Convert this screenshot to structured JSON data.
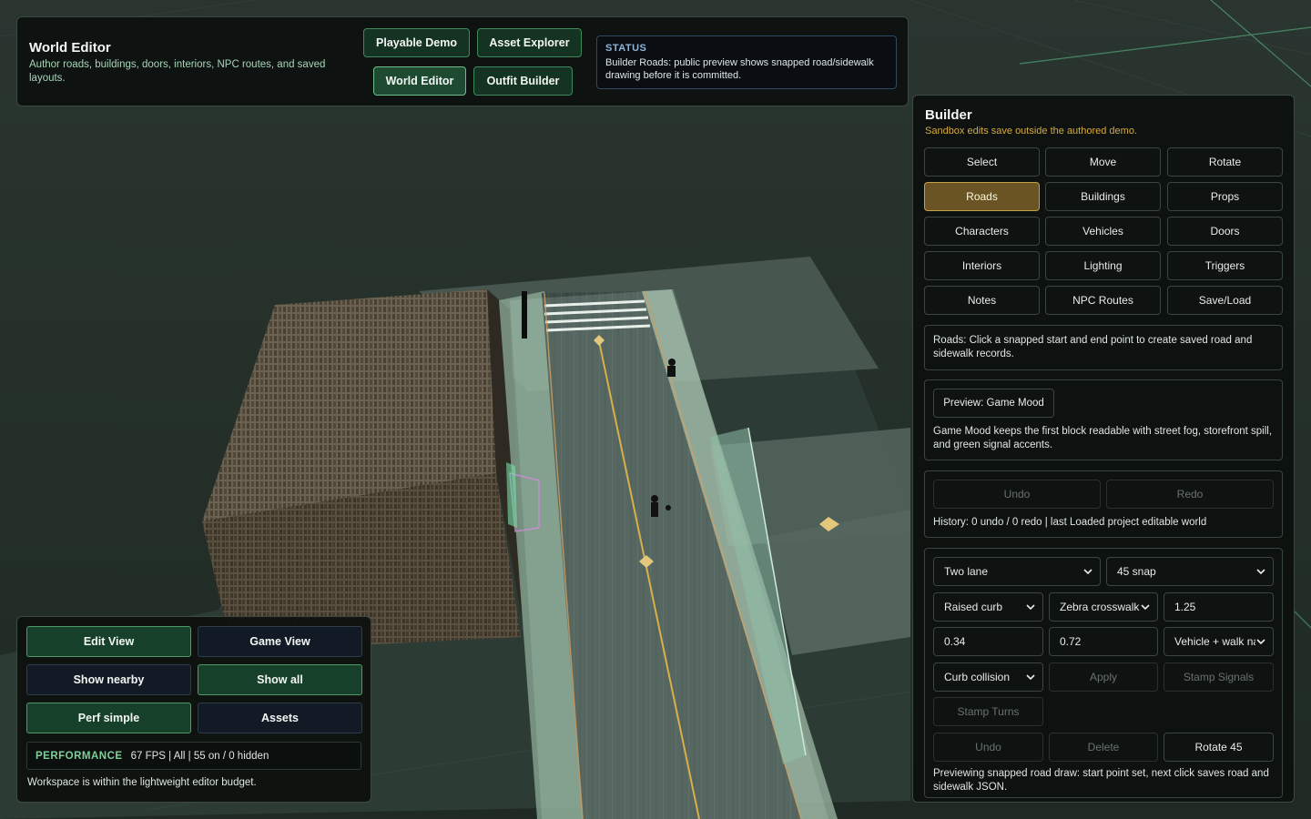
{
  "topbar": {
    "title": "World Editor",
    "subtitle": "Author roads, buildings, doors, interiors, NPC routes, and saved layouts.",
    "nav": {
      "playable_demo": "Playable Demo",
      "asset_explorer": "Asset Explorer",
      "world_editor": "World Editor",
      "outfit_builder": "Outfit Builder"
    },
    "status_label": "STATUS",
    "status_text": "Builder Roads: public preview shows snapped road/sidewalk drawing before it is committed."
  },
  "builder": {
    "title": "Builder",
    "subtitle": "Sandbox edits save outside the authored demo.",
    "tools": [
      "Select",
      "Move",
      "Rotate",
      "Roads",
      "Buildings",
      "Props",
      "Characters",
      "Vehicles",
      "Doors",
      "Interiors",
      "Lighting",
      "Triggers",
      "Notes",
      "NPC Routes",
      "Save/Load"
    ],
    "active_tool": "Roads",
    "roads_help": "Roads: Click a snapped start and end point to create saved road and sidewalk records.",
    "preview_button": "Preview: Game Mood",
    "preview_text": "Game Mood keeps the first block readable with street fog, storefront spill, and green signal accents.",
    "undo": "Undo",
    "redo": "Redo",
    "history": "History: 0 undo / 0 redo | last Loaded project editable world",
    "road_type": "Two lane",
    "snap": "45 snap",
    "curb": "Raised curb",
    "crosswalk": "Zebra crosswalk",
    "value_a": "1.25",
    "value_b": "0.34",
    "value_c": "0.72",
    "nav_mode": "Vehicle + walk nav",
    "collision": "Curb collision",
    "apply": "Apply",
    "stamp_signals": "Stamp Signals",
    "stamp_turns": "Stamp Turns",
    "undo2": "Undo",
    "delete": "Delete",
    "rotate45": "Rotate 45",
    "footer": "Previewing snapped road draw: start point set, next click saves road and sidewalk JSON."
  },
  "viewpanel": {
    "edit_view": "Edit View",
    "game_view": "Game View",
    "show_nearby": "Show nearby",
    "show_all": "Show all",
    "perf_simple": "Perf simple",
    "assets": "Assets",
    "perf_label": "PERFORMANCE",
    "perf_value": "67 FPS | All | 55 on / 0 hidden",
    "budget": "Workspace is within the lightweight editor budget."
  },
  "colors": {
    "accent_green": "#3f8a5a",
    "active_tool": "#6b5423",
    "subtitle_gold": "#d8a93a",
    "status_blue": "#8fb6d8"
  }
}
